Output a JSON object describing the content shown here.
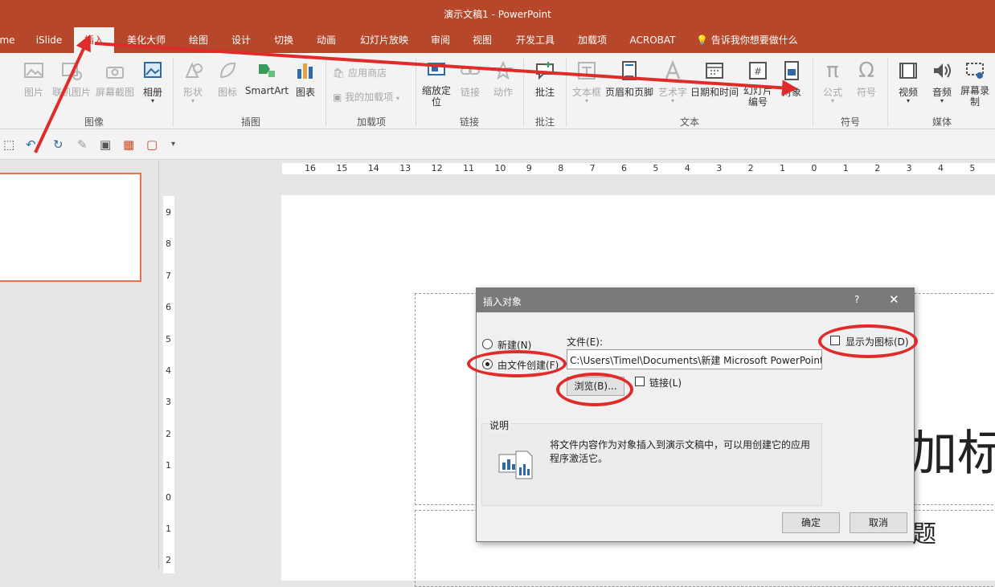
{
  "app": {
    "title": "演示文稿1  -  PowerPoint"
  },
  "tabs": [
    {
      "label": "me"
    },
    {
      "label": "iSlide"
    },
    {
      "label": "插入"
    },
    {
      "label": "美化大师"
    },
    {
      "label": "绘图"
    },
    {
      "label": "设计"
    },
    {
      "label": "切换"
    },
    {
      "label": "动画"
    },
    {
      "label": "幻灯片放映"
    },
    {
      "label": "审阅"
    },
    {
      "label": "视图"
    },
    {
      "label": "开发工具"
    },
    {
      "label": "加载项"
    },
    {
      "label": "ACROBAT"
    },
    {
      "label": "告诉我你想要做什么"
    }
  ],
  "ribbon": {
    "items": {
      "picture": "图片",
      "online_picture": "联机图片",
      "screenshot": "屏幕截图",
      "album": "相册",
      "shapes": "形状",
      "icons": "图标",
      "smartart": "SmartArt",
      "chart": "图表",
      "store": "应用商店",
      "my_addins": "我的加载项",
      "zoom": "缩放定位",
      "link": "链接",
      "action": "动作",
      "comment": "批注",
      "textbox": "文本框",
      "header_footer": "页眉和页脚",
      "wordart": "艺术字",
      "datetime": "日期和时间",
      "slide_number": "幻灯片编号",
      "object": "对象",
      "equation": "公式",
      "symbol": "符号",
      "video": "视频",
      "audio": "音频",
      "screen_record": "屏幕录制"
    },
    "groups": {
      "images": "图像",
      "illustrations": "插图",
      "addins": "加载项",
      "links": "链接",
      "comments": "批注",
      "text": "文本",
      "symbols": "符号",
      "media": "媒体"
    }
  },
  "ruler": {
    "h": [
      "16",
      "15",
      "14",
      "13",
      "12",
      "11",
      "10",
      "9",
      "8",
      "7",
      "6",
      "5",
      "4",
      "3",
      "2",
      "1",
      "0",
      "1",
      "2",
      "3",
      "4",
      "5"
    ],
    "v": [
      "9",
      "8",
      "7",
      "6",
      "5",
      "4",
      "3",
      "2",
      "1",
      "0",
      "1",
      "2"
    ]
  },
  "slide": {
    "title_partial": "加标",
    "subtitle_partial": "题"
  },
  "dialog": {
    "title": "插入对象",
    "help": "?",
    "close": "✕",
    "radio_new": "新建(N)",
    "radio_from_file": "由文件创建(F)",
    "file_label": "文件(E):",
    "file_path": "C:\\Users\\Timel\\Documents\\新建 Microsoft PowerPoint",
    "browse": "浏览(B)...",
    "link": "链接(L)",
    "display_as_icon": "显示为图标(D)",
    "desc_label": "说明",
    "desc_text": "将文件内容作为对象插入到演示文稿中，可以用创建它的应用程序激活它。",
    "ok": "确定",
    "cancel": "取消"
  },
  "colors": {
    "accent": "#b7472a",
    "annotation": "#e02b2b",
    "thumb_border": "#e07454"
  }
}
